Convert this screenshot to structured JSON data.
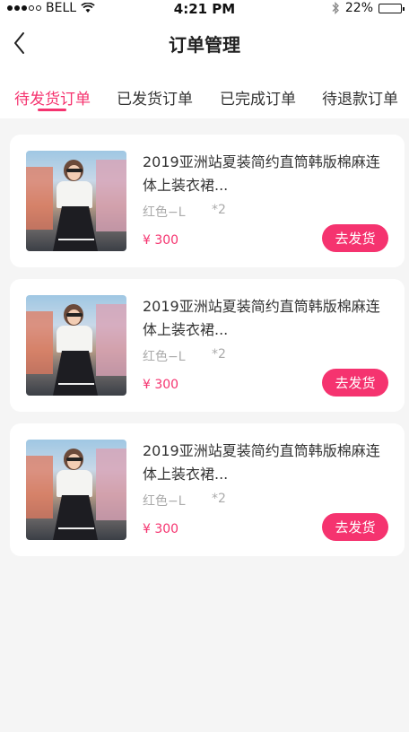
{
  "status_bar": {
    "carrier": "BELL",
    "time": "4:21 PM",
    "battery": "22%",
    "battery_level": 0.22
  },
  "header": {
    "title": "订单管理",
    "back_icon": "chevron-left-icon"
  },
  "tabs": [
    {
      "label": "待发货订单",
      "active": true
    },
    {
      "label": "已发货订单",
      "active": false
    },
    {
      "label": "已完成订单",
      "active": false
    },
    {
      "label": "待退款订单",
      "active": false
    }
  ],
  "orders": [
    {
      "title": "2019亚洲站夏装简约直筒韩版棉麻连体上装衣裙...",
      "spec": "红色−L",
      "qty": "*2",
      "price": "¥ 300",
      "action": "去发货"
    },
    {
      "title": "2019亚洲站夏装简约直筒韩版棉麻连体上装衣裙...",
      "spec": "红色−L",
      "qty": "*2",
      "price": "¥ 300",
      "action": "去发货"
    },
    {
      "title": "2019亚洲站夏装简约直筒韩版棉麻连体上装衣裙...",
      "spec": "红色−L",
      "qty": "*2",
      "price": "¥ 300",
      "action": "去发货"
    }
  ],
  "colors": {
    "accent": "#f5336f",
    "background": "#f5f5f5"
  }
}
